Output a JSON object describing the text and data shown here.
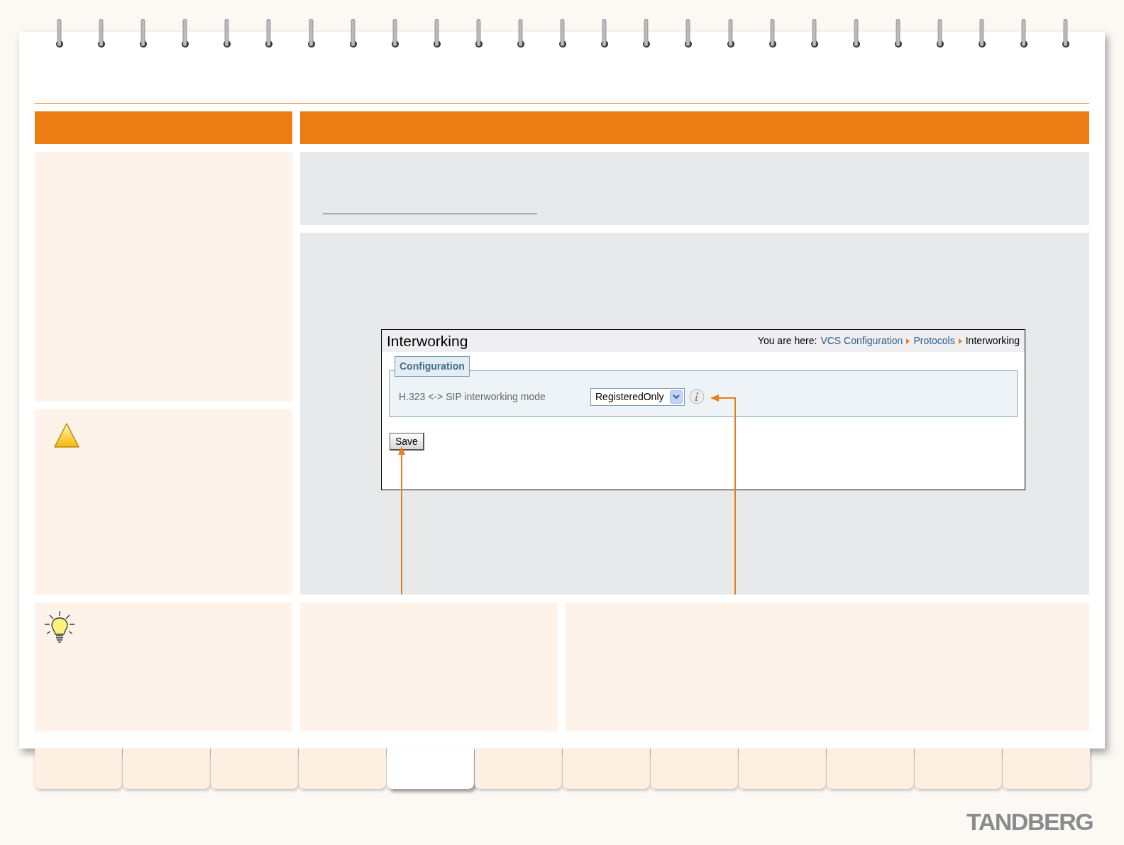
{
  "screenshot": {
    "title": "Interworking",
    "breadcrumb": {
      "prefix": "You are here:",
      "links": [
        "VCS Configuration",
        "Protocols"
      ],
      "current": "Interworking"
    },
    "section": "Configuration",
    "field": {
      "label": "H.323 <-> SIP interworking mode",
      "value": "RegisteredOnly"
    },
    "save_button": "Save"
  },
  "tabs": [
    {
      "selected": false
    },
    {
      "selected": false
    },
    {
      "selected": false
    },
    {
      "selected": false
    },
    {
      "selected": true
    },
    {
      "selected": false
    },
    {
      "selected": false
    },
    {
      "selected": false
    },
    {
      "selected": false
    },
    {
      "selected": false
    },
    {
      "selected": false
    },
    {
      "selected": false
    }
  ],
  "logo": "TANDBERG"
}
